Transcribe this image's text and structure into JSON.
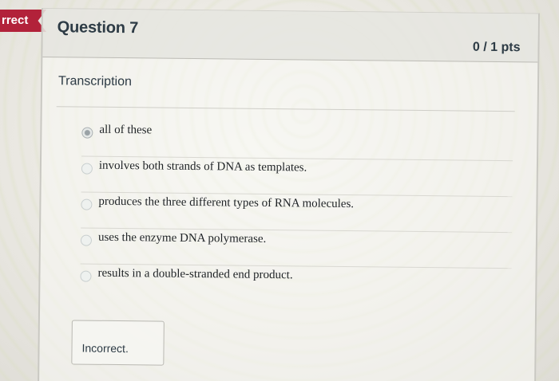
{
  "status_banner": {
    "label": "rrect"
  },
  "question": {
    "title": "Question 7",
    "points": "0 / 1 pts",
    "prompt": "Transcription"
  },
  "answers": [
    {
      "text": "all of these",
      "selected": true
    },
    {
      "text": "involves both strands of DNA as templates.",
      "selected": false
    },
    {
      "text": "produces the three different types of RNA molecules.",
      "selected": false
    },
    {
      "text": "uses the enzyme DNA polymerase.",
      "selected": false
    },
    {
      "text": "results in a double-stranded end product.",
      "selected": false
    }
  ],
  "feedback": {
    "text": "Incorrect."
  },
  "colors": {
    "banner": "#b2223a",
    "heading_text": "#2d3b45"
  }
}
